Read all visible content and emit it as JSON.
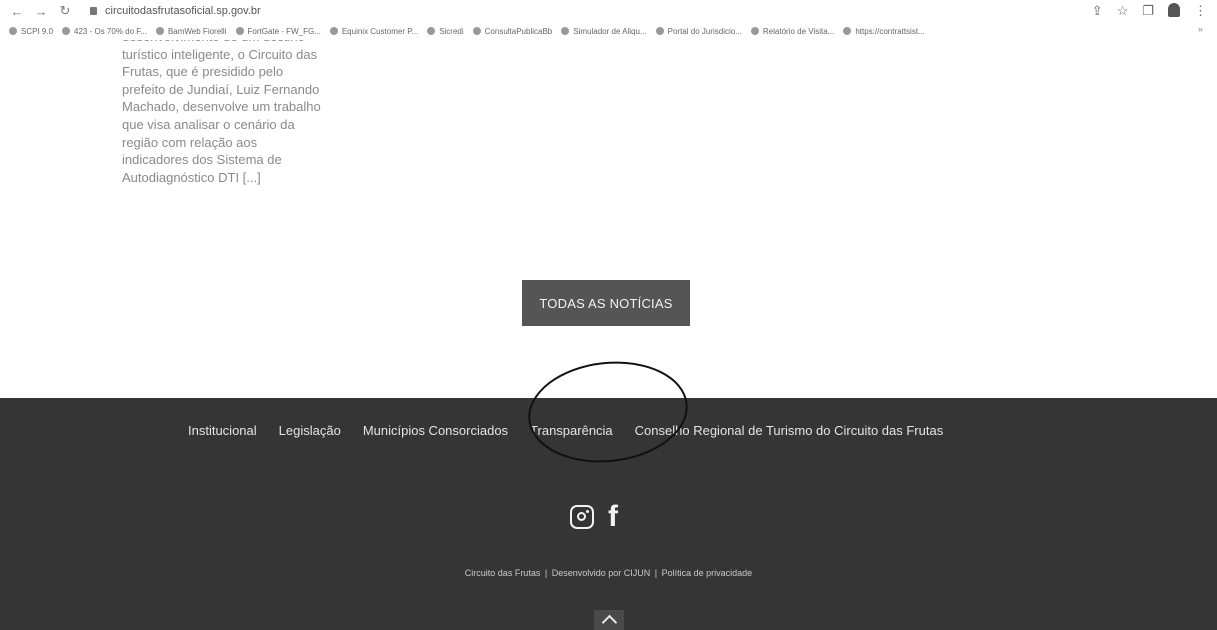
{
  "browser": {
    "url": "circuitodasfrutasoficial.sp.gov.br",
    "bookmarks": [
      "SCPI 9.0",
      "423 - Os 70% do F...",
      "BamWeb Fiorelli",
      "FortGate - FW_FG...",
      "Equinix Customer P...",
      "Sicredi",
      "ConsultaPublicaBb",
      "Simulador de Aliqu...",
      "Portal do Jurisdicio...",
      "Relatório de Visita...",
      "https://contrattsist..."
    ]
  },
  "excerpt": {
    "text": "desenvolvimento de um destino\nturístico inteligente, o Circuito das\nFrutas, que é presidido pelo\nprefeito de Jundiaí, Luiz Fernando\nMachado, desenvolve um trabalho\nque visa analisar o cenário da\nregião com relação aos\nindicadores dos Sistema de\nAutodiagnóstico DTI [...]"
  },
  "all_news_button": "TODAS AS NOTÍCIAS",
  "footer": {
    "nav": [
      "Institucional",
      "Legislação",
      "Municípios Consorciados",
      "Transparência",
      "Conselho Regional de Turismo do Circuito das Frutas"
    ],
    "credits": {
      "part1": "Circuito das Frutas",
      "sep": "|",
      "part2": "Desenvolvido por CIJUN",
      "part3": "Política de privacidade"
    }
  }
}
